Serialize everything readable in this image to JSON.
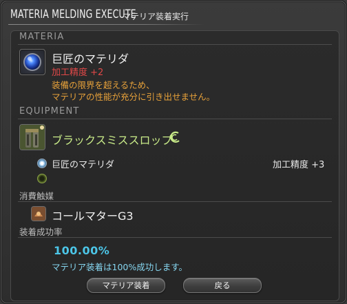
{
  "window": {
    "title_en": "MATERIA MELDING EXECUTE",
    "title_jp": "マテリア装着実行"
  },
  "materia": {
    "section_label": "MATERIA",
    "name": "巨匠のマテリダ",
    "bonus": "加工精度 +2",
    "warning_line1": "装備の限界を超えるため、",
    "warning_line2": "マテリアの性能が充分に引き出せません。",
    "icon": "blue-materia-orb-icon"
  },
  "equipment": {
    "section_label": "EQUIPMENT",
    "name": "ブラックスミススロップ",
    "icon": "blacksmith-slops-icon",
    "badge_icon": "crafter-gear-icon",
    "slots": [
      {
        "name": "巨匠のマテリダ",
        "stat": "加工精度 +3",
        "state": "filled"
      },
      {
        "name": "",
        "stat": "",
        "state": "empty"
      }
    ]
  },
  "catalyst": {
    "section_label": "消費触媒",
    "name": "コールマターG3",
    "icon": "coal-matter-icon"
  },
  "success": {
    "section_label": "装着成功率",
    "rate": "100.00%",
    "message": "マテリア装着は100%成功します。"
  },
  "buttons": {
    "confirm": "マテリア装着",
    "cancel": "戻る"
  },
  "colors": {
    "warning": "#e8a23a",
    "bonus_red": "#e04848",
    "equipment_green": "#c8ea88",
    "rate_blue": "#4cc6e8"
  }
}
